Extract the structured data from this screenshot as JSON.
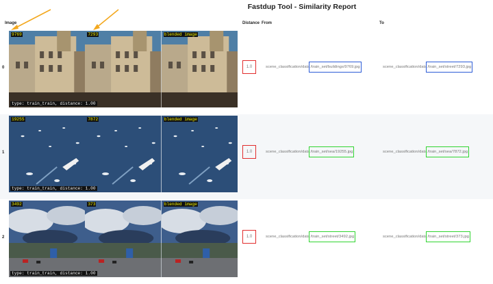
{
  "report": {
    "title": "Fastdup Tool - Similarity Report",
    "columns": {
      "image": "Image",
      "distance": "Distance",
      "from": "From",
      "to": "To"
    }
  },
  "colors": {
    "highlight_blue": "#2b5bd6",
    "highlight_green": "#2fd42f",
    "distance_box": "#e12b2b",
    "arrow": "#f3a81e",
    "label_yellow": "#f5f500"
  },
  "rows": [
    {
      "index": "0",
      "from_id": "9769",
      "to_id": "7293",
      "blended_label": "blended image",
      "caption": "type: train_train, distance: 1.00",
      "distance": "1.0",
      "from_prefix": "scene_classification/data",
      "from_highlight": "/train_set/buildings/9769.jpg",
      "to_prefix": "scene_classification/data",
      "to_highlight": "/train_set/street/7293.jpg",
      "highlight": "blue"
    },
    {
      "index": "1",
      "from_id": "19255",
      "to_id": "7872",
      "blended_label": "blended image",
      "caption": "type: train_train, distance: 1.00",
      "distance": "1.0",
      "from_prefix": "scene_classification/data",
      "from_highlight": "/train_set/sea/19255.jpg",
      "to_prefix": "scene_classification/data",
      "to_highlight": "/train_set/sea/7872.jpg",
      "highlight": "green"
    },
    {
      "index": "2",
      "from_id": "3492",
      "to_id": "373",
      "blended_label": "blended image",
      "caption": "type: train_train, distance: 1.00",
      "distance": "1.0",
      "from_prefix": "scene_classification/data",
      "from_highlight": "/train_set/street/3492.jpg",
      "to_prefix": "scene_classification/data",
      "to_highlight": "/train_set/street/373.jpg",
      "highlight": "green"
    }
  ]
}
